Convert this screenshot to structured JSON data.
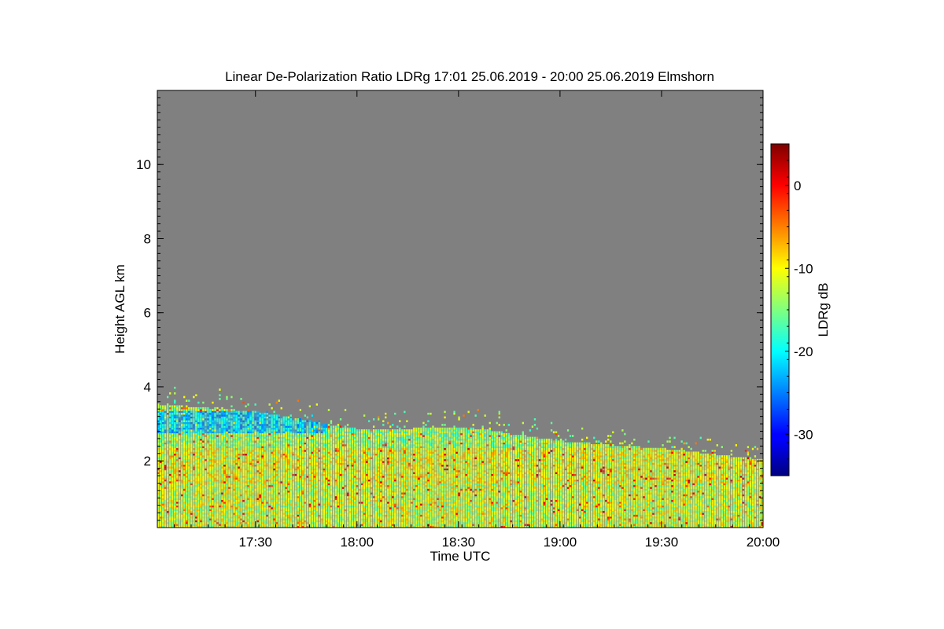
{
  "chart_data": {
    "type": "heatmap",
    "title": "Linear De-Polarization Ratio LDRg   17:01 25.06.2019 - 20:00 25.06.2019 Elmshorn",
    "xlabel": "Time UTC",
    "ylabel": "Height AGL km",
    "colorbar_label": "LDRg dB",
    "x_range": [
      "17:01",
      "20:00"
    ],
    "y_range_km": [
      0.2,
      12.0
    ],
    "x_ticks": [
      {
        "label": "17:30",
        "minutes": 29
      },
      {
        "label": "18:00",
        "minutes": 59
      },
      {
        "label": "18:30",
        "minutes": 89
      },
      {
        "label": "19:00",
        "minutes": 119
      },
      {
        "label": "19:30",
        "minutes": 149
      },
      {
        "label": "20:00",
        "minutes": 179
      }
    ],
    "y_ticks": [
      {
        "label": "2",
        "value": 2
      },
      {
        "label": "4",
        "value": 4
      },
      {
        "label": "6",
        "value": 6
      },
      {
        "label": "8",
        "value": 8
      },
      {
        "label": "10",
        "value": 10
      }
    ],
    "colorbar_range_db": [
      -35,
      5
    ],
    "colorbar_ticks": [
      {
        "label": "0",
        "value": 0
      },
      {
        "label": "-10",
        "value": -10
      },
      {
        "label": "-20",
        "value": -20
      },
      {
        "label": "-30",
        "value": -30
      }
    ],
    "colormap": "jet",
    "no_data_color": "#808080",
    "signal_top_km": [
      {
        "minutes": 0,
        "value": 3.5
      },
      {
        "minutes": 30,
        "value": 3.3
      },
      {
        "minutes": 60,
        "value": 2.8
      },
      {
        "minutes": 90,
        "value": 2.9
      },
      {
        "minutes": 120,
        "value": 2.5
      },
      {
        "minutes": 150,
        "value": 2.3
      },
      {
        "minutes": 179,
        "value": 2.0
      }
    ],
    "layers": [
      {
        "from_minutes": 0,
        "to_minutes": 50,
        "height_range_km": [
          2.7,
          3.3
        ],
        "ldr_db": -21
      },
      {
        "from_minutes": 0,
        "to_minutes": 179,
        "height_range_km": [
          1.4,
          2.3
        ],
        "ldr_db": -11
      },
      {
        "from_minutes": 0,
        "to_minutes": 179,
        "height_range_km": [
          0.2,
          1.4
        ],
        "ldr_db": -12
      }
    ]
  }
}
